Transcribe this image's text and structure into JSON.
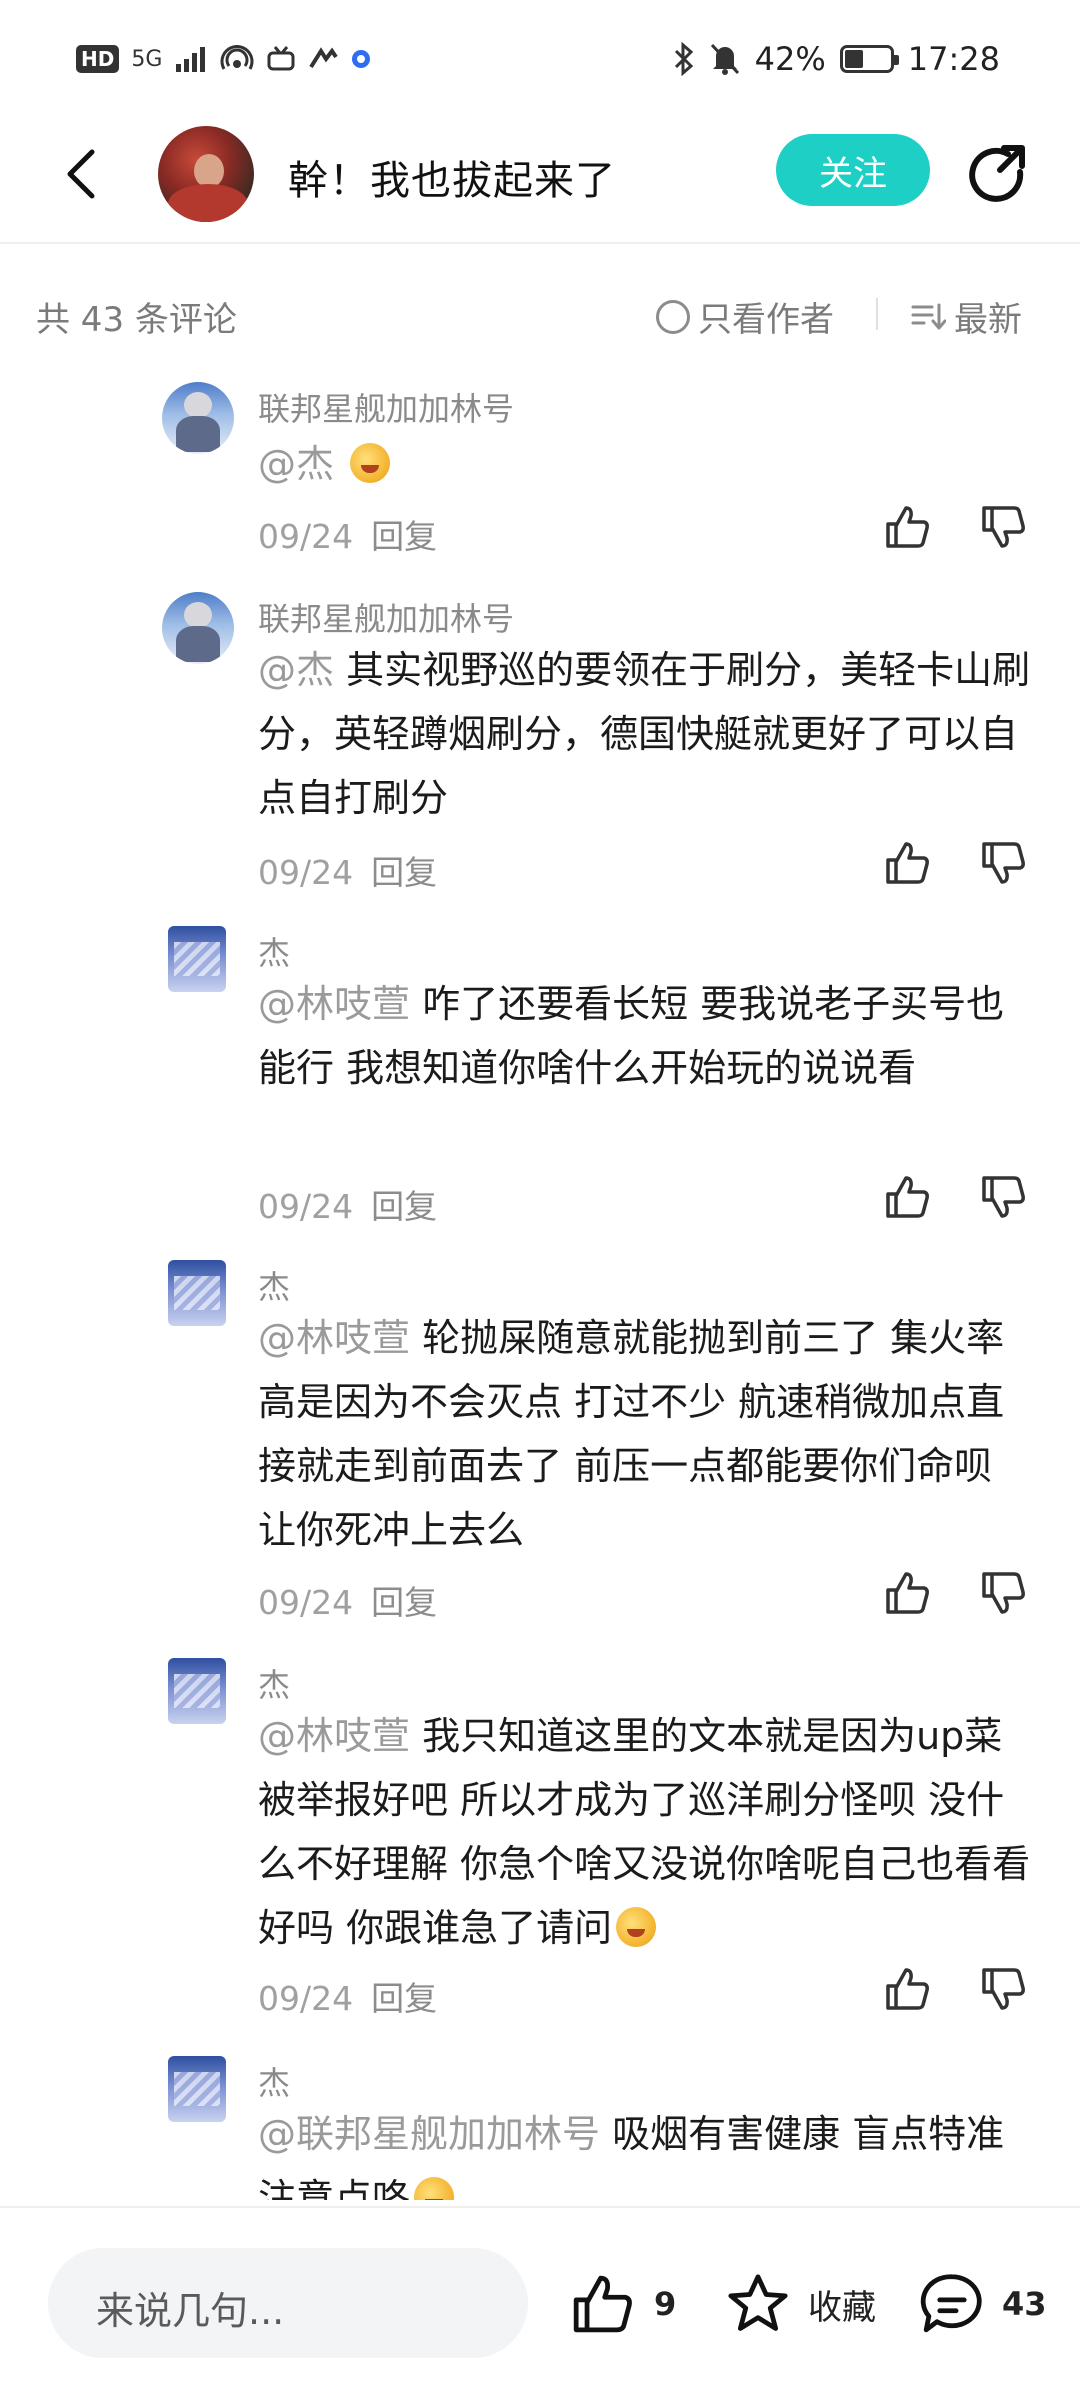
{
  "status_bar": {
    "left_label": "HD",
    "network": "5G",
    "battery": "42%",
    "battery_level": 0.42,
    "time": "17:28"
  },
  "header": {
    "title": "幹！我也拔起来了",
    "follow_label": "关注"
  },
  "comment_bar": {
    "count_label": "共 43 条评论",
    "only_author_label": "只看作者",
    "sort_label": "最新"
  },
  "comments": [
    {
      "name": "联邦星舰加加林号",
      "mention": "@杰",
      "text": "",
      "has_emoji": true,
      "date": "09/24",
      "reply_label": "回复"
    },
    {
      "name": "联邦星舰加加林号",
      "mention": "@杰",
      "text": " 其实视野巡的要领在于刷分，美轻卡山刷分，英轻蹲烟刷分，德国快艇就更好了可以自点自打刷分",
      "has_emoji": false,
      "date": "09/24",
      "reply_label": "回复"
    },
    {
      "name": "杰",
      "mention": "@林吱萱",
      "text": " 咋了还要看长短  要我说老子买号也能行  我想知道你啥什么开始玩的说说看",
      "has_emoji": false,
      "date": "09/24",
      "reply_label": "回复"
    },
    {
      "name": "杰",
      "mention": "@林吱萱",
      "text": " 轮抛屎随意就能抛到前三了 集火率高是因为不会灭点  打过不少  航速稍微加点直接就走到前面去了  前压一点都能要你们命呗  让你死冲上去么",
      "has_emoji": false,
      "date": "09/24",
      "reply_label": "回复"
    },
    {
      "name": "杰",
      "mention": "@林吱萱",
      "text": " 我只知道这里的文本就是因为up菜被举报好吧 所以才成为了巡洋刷分怪呗 没什么不好理解 你急个啥又没说你啥呢自己也看看好吗  你跟谁急了请问",
      "has_emoji": true,
      "date": "09/24",
      "reply_label": "回复"
    },
    {
      "name": "杰",
      "mention": "@联邦星舰加加林号",
      "text": " 吸烟有害健康  盲点特准 注意点咯",
      "has_emoji": true,
      "date": "",
      "reply_label": ""
    }
  ],
  "bottom_bar": {
    "input_placeholder": "来说几句...",
    "like_count": "9",
    "favorite_label": "收藏",
    "comment_count": "43"
  }
}
